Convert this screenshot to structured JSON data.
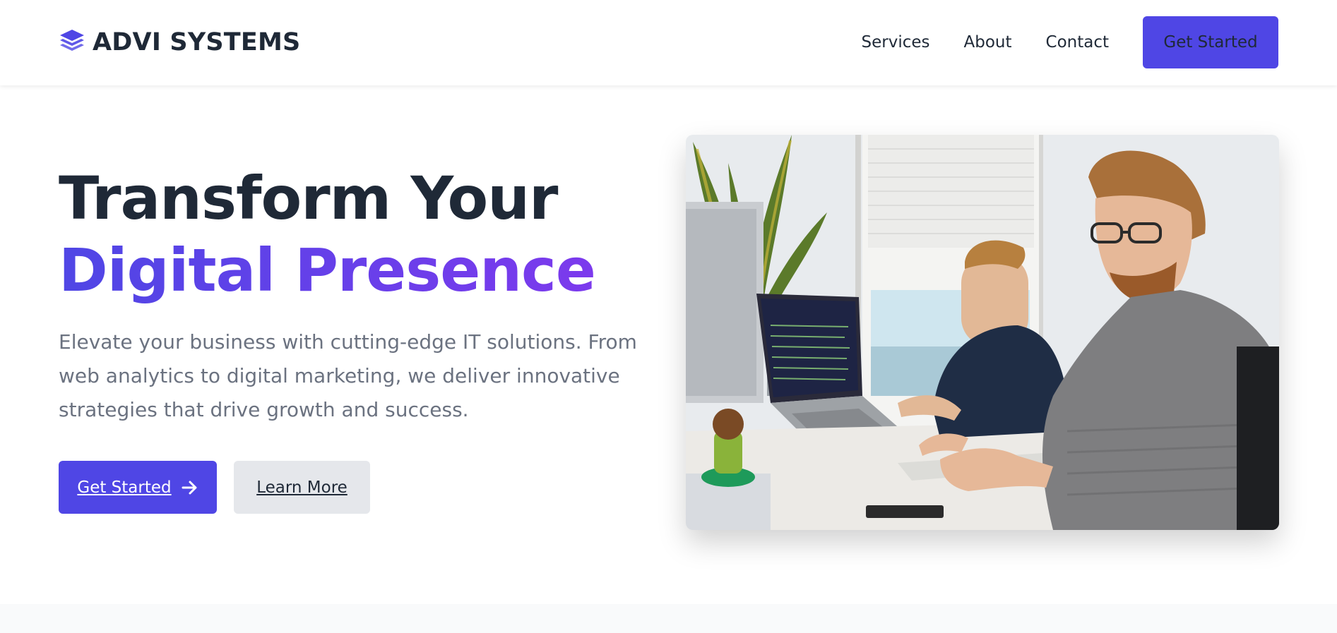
{
  "brand": {
    "name": "ADVI SYSTEMS",
    "icon": "layers-icon",
    "accent": "#4f46e5"
  },
  "nav": {
    "items": [
      "Services",
      "About",
      "Contact"
    ],
    "cta_label": "Get Started"
  },
  "hero": {
    "title_line1": "Transform Your",
    "title_line2": "Digital Presence",
    "subtitle": "Elevate your business with cutting-edge IT solutions. From web analytics to digital marketing, we deliver innovative strategies that drive growth and success.",
    "primary_button": "Get Started",
    "primary_button_icon": "arrow-right-icon",
    "secondary_button": "Learn More",
    "gradient_start": "#4f46e5",
    "gradient_end": "#7c3aed"
  }
}
